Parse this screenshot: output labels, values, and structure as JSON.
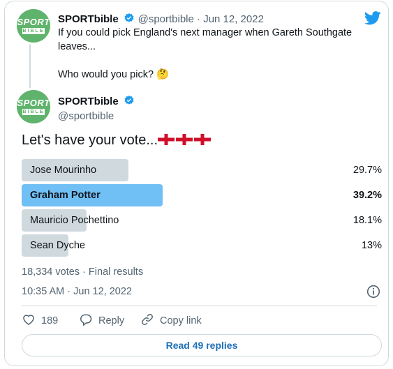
{
  "quoted_tweet": {
    "author_name": "SPORTbible",
    "handle_date": "@sportbible · Jun 12, 2022",
    "text_line1": "If you could pick England's next manager when Gareth Southgate",
    "text_line2": "leaves...",
    "text_line3": "Who would you pick? 🤔"
  },
  "tweet": {
    "author_name": "SPORTbible",
    "handle": "@sportbible",
    "text": "Let's have your vote..."
  },
  "avatar": {
    "line1": "SPORT",
    "line2": "BIBLE"
  },
  "poll": {
    "options": [
      {
        "label": "Jose Mourinho",
        "percent": "29.7%",
        "value": 29.7,
        "winner": false
      },
      {
        "label": "Graham Potter",
        "percent": "39.2%",
        "value": 39.2,
        "winner": true
      },
      {
        "label": "Mauricio Pochettino",
        "percent": "18.1%",
        "value": 18.1,
        "winner": false
      },
      {
        "label": "Sean Dyche",
        "percent": "13%",
        "value": 13,
        "winner": false
      }
    ],
    "meta": "18,334 votes · Final results"
  },
  "timestamp": "10:35 AM · Jun 12, 2022",
  "actions": {
    "like_count": "189",
    "reply_label": "Reply",
    "copy_link_label": "Copy link"
  },
  "read_replies_label": "Read 49 replies",
  "colors": {
    "twitter_blue": "#1d9bf0",
    "winner_bar": "#70bff5",
    "bar": "#cfd9de",
    "avatar_green": "#5fb36c"
  }
}
